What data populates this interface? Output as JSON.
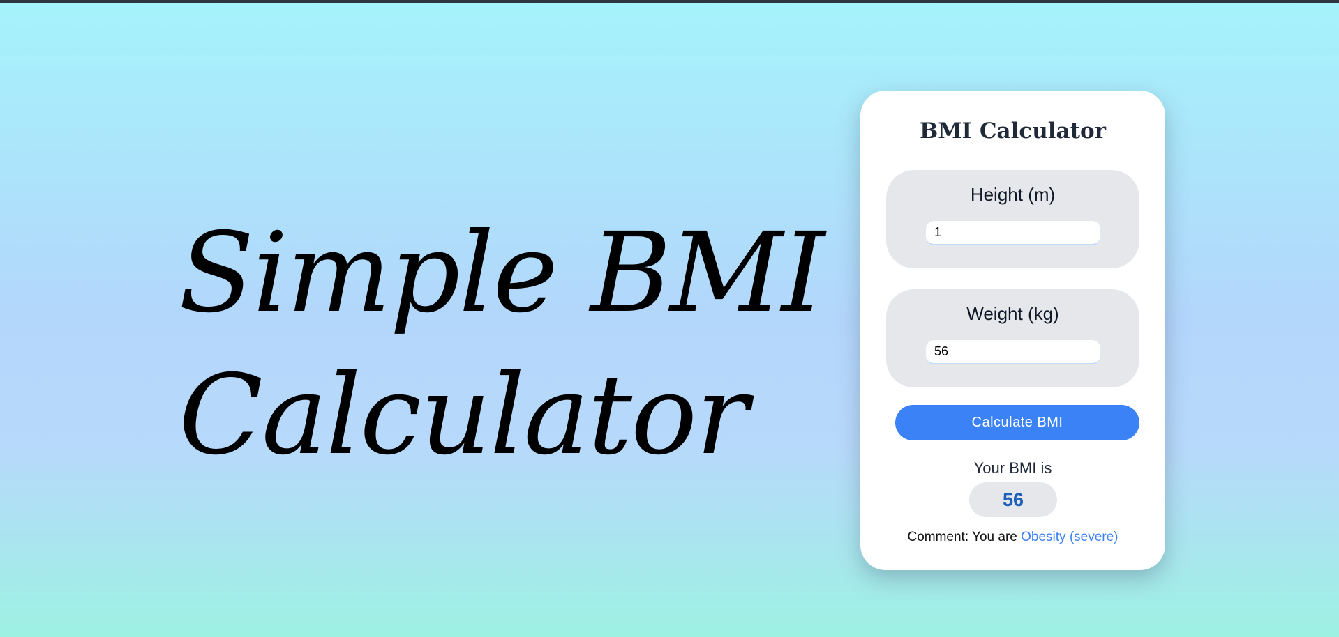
{
  "hero": {
    "line1": "Simple BMI",
    "line2": "Calculator"
  },
  "card": {
    "title": "BMI Calculator",
    "height_field": {
      "label": "Height (m)",
      "value": "1"
    },
    "weight_field": {
      "label": "Weight (kg)",
      "value": "56"
    },
    "calculate_label": "Calculate BMI",
    "result": {
      "label": "Your BMI is",
      "value": "56"
    },
    "comment": {
      "prefix": "Comment: You are",
      "category": "Obesity (severe)"
    }
  },
  "colors": {
    "accent": "#3b82f6",
    "result_text": "#1e5fb8",
    "field_background": "#e5e7eb",
    "card_background": "#ffffff",
    "gradient_top": "#a5f3fb",
    "gradient_middle": "#b3d6fb",
    "gradient_bottom": "#9df1e3"
  }
}
